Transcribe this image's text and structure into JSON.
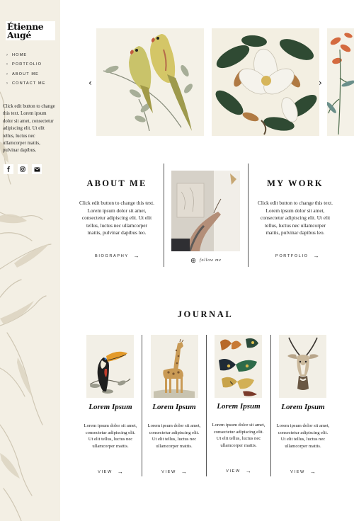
{
  "site": {
    "logo_line1": "Étienne",
    "logo_line2": "Augé"
  },
  "nav": [
    {
      "label": "HOME"
    },
    {
      "label": "PORTFOLIO"
    },
    {
      "label": "ABOUT ME"
    },
    {
      "label": "CONTACT ME"
    }
  ],
  "sidebar": {
    "text": "Click edit button to change this text. Lorem ipsum dolor sit amet, consectetur adipiscing elit. Ut elit tellus, luctus nec ullamcorper mattis, pulvinar dapibus.",
    "social": [
      "facebook-icon",
      "instagram-icon",
      "mail-icon"
    ]
  },
  "slider": {
    "prev_glyph": "‹",
    "next_glyph": "›",
    "slides": [
      "parrots",
      "magnolia",
      "lily"
    ]
  },
  "about": {
    "title": "ABOUT ME",
    "text": "Click edit button to change this text. Lorem ipsum dolor sit amet, consectetur adipiscing elit. Ut elit tellus, luctus nec ullamcorper mattis, pulvinar dapibus leo.",
    "cta": "BIOGRAPHY"
  },
  "work": {
    "title": "MY WORK",
    "text": "Click edit button to change this text. Lorem ipsum dolor sit amet, consectetur adipiscing elit. Ut elit tellus, luctus nec ullamcorper mattis, pulvinar dapibus leo.",
    "cta": "PORTFOLIO"
  },
  "follow": {
    "label": "follow me"
  },
  "journal": {
    "title": "JOURNAL",
    "cards": [
      {
        "title": "Lorem Ipsum",
        "text": "Lorem ipsum dolor sit amet, consectetur adipiscing elit. Ut elit tellus, luctus nec ullamcorper mattis.",
        "cta": "VIEW",
        "image": "toucan"
      },
      {
        "title": "Lorem Ipsum",
        "text": "Lorem ipsum dolor sit amet, consectetur adipiscing elit. Ut elit tellus, luctus nec ullamcorper mattis.",
        "cta": "VIEW",
        "image": "giraffe"
      },
      {
        "title": "Lorem Ipsum",
        "text": "Lorem ipsum dolor sit amet, consectetur adipiscing elit. Ut elit tellus, luctus nec ullamcorper mattis.",
        "cta": "VIEW",
        "image": "butterflies"
      },
      {
        "title": "Lorem Ipsum",
        "text": "Lorem ipsum dolor sit amet, consectetur adipiscing elit. Ut elit tellus, luctus nec ullamcorper mattis.",
        "cta": "VIEW",
        "image": "antelope"
      }
    ]
  },
  "colors": {
    "sidebar_bg": "#f3efe4",
    "text": "#222222",
    "rule": "#555555"
  }
}
